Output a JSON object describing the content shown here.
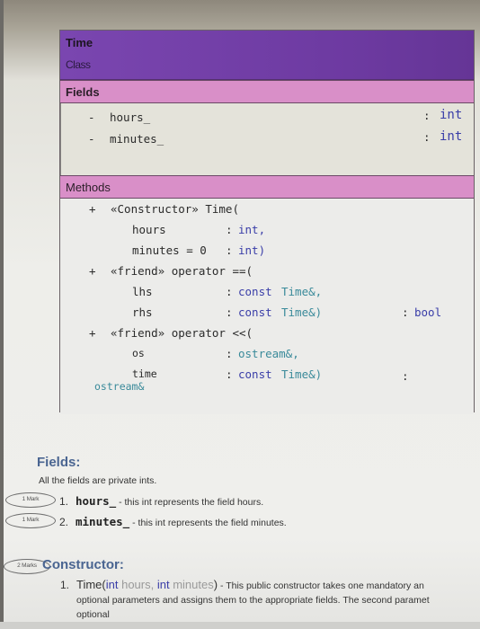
{
  "uml": {
    "class_name": "Time",
    "stereotype": "Class",
    "fields_header": "Fields",
    "methods_header": "Methods",
    "fields": [
      {
        "visibility": "-",
        "name": "hours_",
        "sep": ":",
        "type": "int"
      },
      {
        "visibility": "-",
        "name": "minutes_",
        "sep": ":",
        "type": "int"
      }
    ],
    "methods": {
      "constructor": {
        "visibility": "+",
        "signature": "«Constructor» Time(",
        "params": [
          {
            "name": "hours",
            "sep": ":",
            "type": "int,"
          },
          {
            "name": "minutes = 0",
            "sep": ":",
            "type": "int)"
          }
        ]
      },
      "op_eq": {
        "visibility": "+",
        "signature": "«friend» operator ==(",
        "params": [
          {
            "name": "lhs",
            "sep": ":",
            "type_kw": "const",
            "type": "Time&,"
          },
          {
            "name": "rhs",
            "sep": ":",
            "type_kw": "const",
            "type": "Time&)"
          }
        ],
        "return_sep": ":",
        "return_type": "bool"
      },
      "op_out": {
        "visibility": "+",
        "signature": "«friend» operator <<(",
        "params": [
          {
            "name": "os",
            "sep": ":",
            "type": "ostream&,"
          },
          {
            "name": "time",
            "sep": ":",
            "type_kw": "const",
            "type": "Time&)"
          }
        ],
        "return_sep": ":",
        "return_type": "ostream&"
      }
    }
  },
  "doc": {
    "fields_heading": "Fields:",
    "fields_intro": "All the fields are private ints.",
    "field_items": [
      {
        "badge": "1 Mark",
        "num": "1.",
        "code": "hours_",
        "desc": " - this int represents the field hours."
      },
      {
        "badge": "1 Mark",
        "num": "2.",
        "code": "minutes_",
        "desc": " - this int represents the field minutes."
      }
    ],
    "constructor_badge": "2 Marks",
    "constructor_heading": "Constructor:",
    "constructor_item": {
      "num": "1.",
      "sig_name": "Time(",
      "sig_kw1": "int",
      "sig_p1": " hours, ",
      "sig_kw2": "int",
      "sig_p2": " minutes",
      "sig_close": ")",
      "line1": " - This public constructor takes one mandatory an",
      "line2": "optional parameters and assigns them to the appropriate fields. The second paramet",
      "line3": "optional"
    }
  }
}
